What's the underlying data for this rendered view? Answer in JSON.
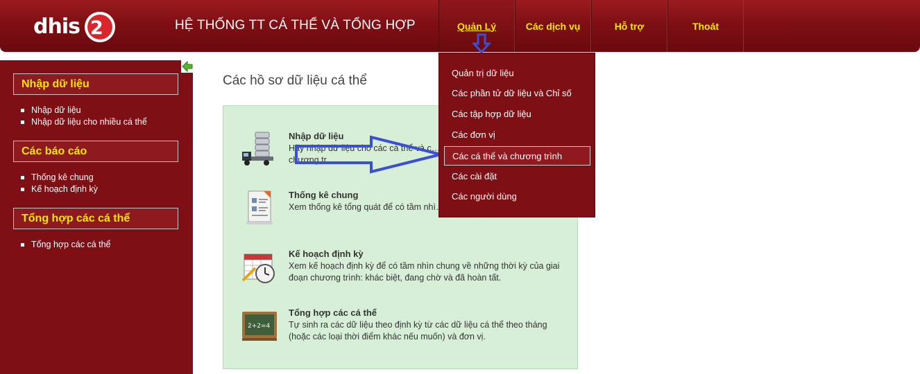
{
  "header": {
    "logo_text": "DHIS2",
    "title": "HỆ THỐNG TT CÁ THỂ VÀ TỔNG HỢP",
    "nav": [
      {
        "label": "Quản Lý"
      },
      {
        "label": "Các dịch vụ"
      },
      {
        "label": "Hỗ trợ"
      },
      {
        "label": "Thoát"
      }
    ]
  },
  "sidebar": {
    "sections": [
      {
        "title": "Nhập dữ liệu",
        "items": [
          "Nhập dữ liệu",
          "Nhập dữ liệu cho nhiều cá thể"
        ]
      },
      {
        "title": "Các báo cáo",
        "items": [
          "Thống kê chung",
          "Kế hoạch định kỳ"
        ]
      },
      {
        "title": "Tổng hợp các cá thể",
        "items": [
          "Tổng hợp các cá thể"
        ]
      }
    ]
  },
  "main": {
    "title": "Các hồ sơ dữ liệu cá thể",
    "items": [
      {
        "icon": "truck-database-icon",
        "title": "Nhập dữ liệu",
        "desc": "Hãy nhập dữ liệu cho các cá thể và c… cùng với các giai đoạn của chương tr…"
      },
      {
        "icon": "document-report-icon",
        "title": "Thống kê chung",
        "desc": "Xem thống kê tổng quát để có tầm nhì… cấp cho một chương trình."
      },
      {
        "icon": "calendar-clock-icon",
        "title": "Kế hoạch định kỳ",
        "desc": "Xem kế hoạch định kỳ để có tầm nhìn chung về những thời kỳ của giai đoạn chương trình: khác biệt, đang chờ và đã hoàn tất."
      },
      {
        "icon": "chalkboard-icon",
        "title": "Tổng hợp các cá thể",
        "desc": "Tự sinh ra các dữ liệu theo định kỳ từ các dữ liệu cá thể theo tháng (hoặc các loại thời điểm khác nếu muốn) và đơn vị."
      }
    ]
  },
  "dropdown": {
    "items": [
      "Quản trị dữ liệu",
      "Các phần tử dữ liệu và Chỉ số",
      "Các tập hợp dữ liệu",
      "Các đơn vị",
      "Các cá thể và chương trình",
      "Các cài đặt",
      "Các người dùng"
    ],
    "highlighted_index": 4
  },
  "colors": {
    "brand_red": "#7e0f14",
    "nav_text": "#ffe600",
    "panel_green": "#d7efd7",
    "annotation_blue": "#3a4fd6"
  }
}
